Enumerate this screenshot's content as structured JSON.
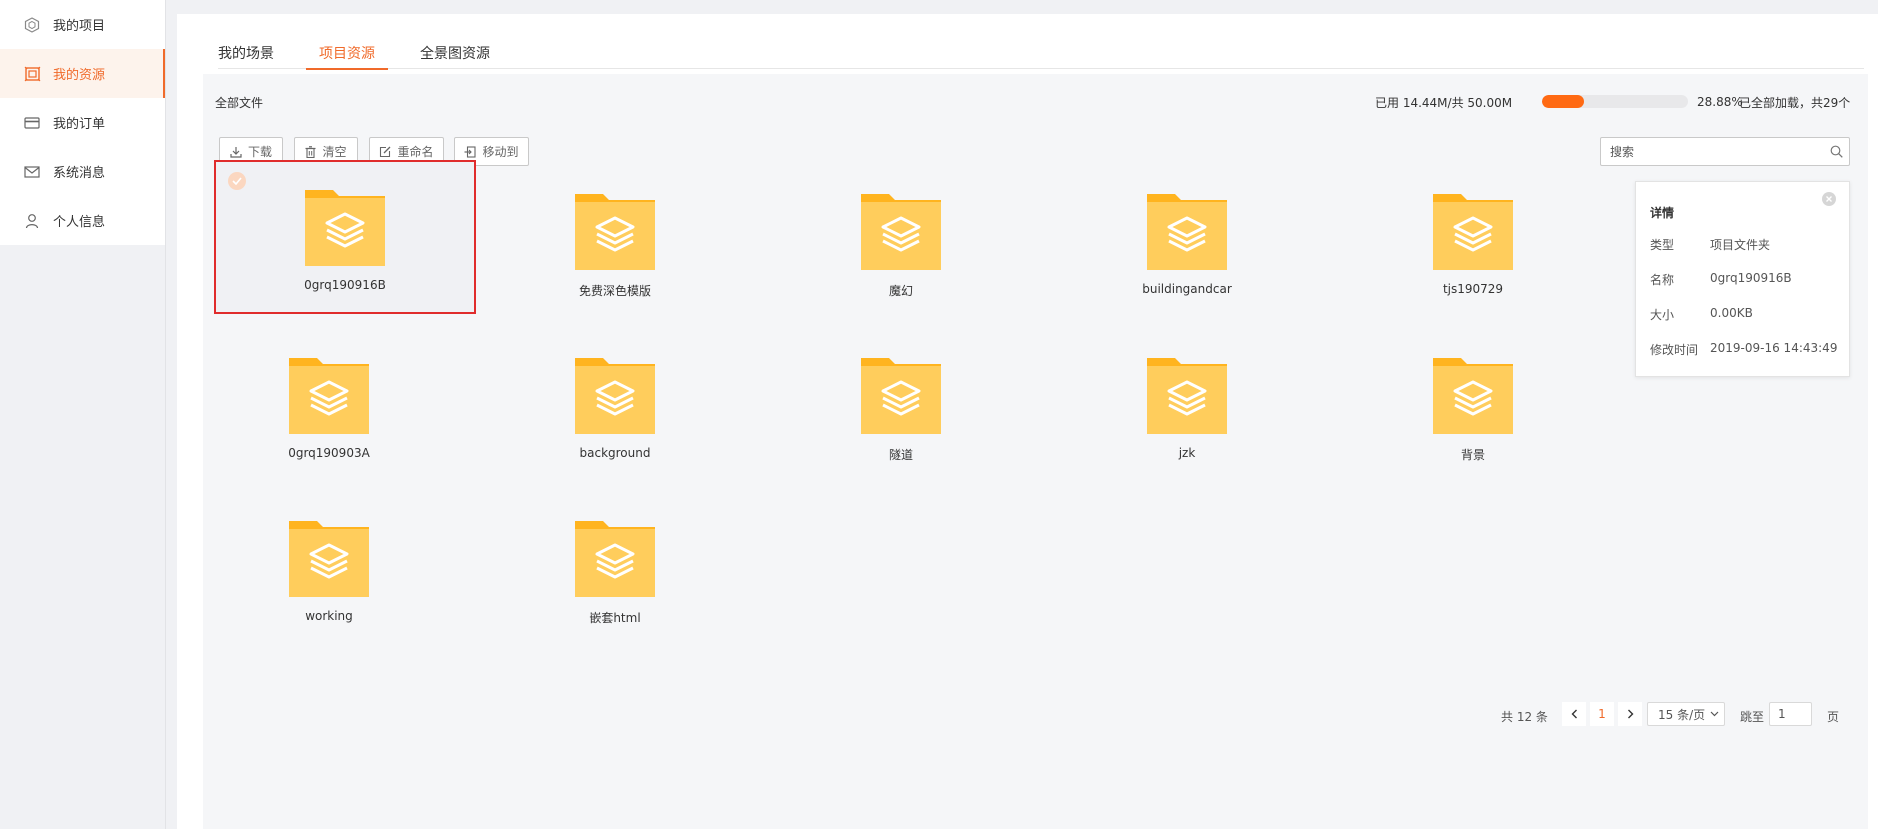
{
  "sidebar": {
    "items": [
      {
        "label": "我的项目",
        "icon": "hexagon-icon",
        "active": false
      },
      {
        "label": "我的资源",
        "icon": "resource-icon",
        "active": true
      },
      {
        "label": "我的订单",
        "icon": "card-icon",
        "active": false
      },
      {
        "label": "系统消息",
        "icon": "mail-icon",
        "active": false
      },
      {
        "label": "个人信息",
        "icon": "user-icon",
        "active": false
      }
    ]
  },
  "tabs": [
    {
      "label": "我的场景",
      "active": false
    },
    {
      "label": "项目资源",
      "active": true
    },
    {
      "label": "全景图资源",
      "active": false
    }
  ],
  "toolbar": {
    "all_files": "全部文件",
    "usage": "已用 14.44M/共 50.00M",
    "usage_fraction": 0.2888,
    "percent": "28.88%",
    "loaded": "已全部加载，共29个",
    "buttons": {
      "download": "下载",
      "clear": "清空",
      "rename": "重命名",
      "move": "移动到"
    },
    "search_placeholder": "搜索"
  },
  "folders": [
    {
      "name": "0grq190916B",
      "selected": true
    },
    {
      "name": "免费深色模版",
      "selected": false
    },
    {
      "name": "魔幻",
      "selected": false
    },
    {
      "name": "buildingandcar",
      "selected": false
    },
    {
      "name": "tjs190729",
      "selected": false
    },
    {
      "name": "0grq190903A",
      "selected": false
    },
    {
      "name": "background",
      "selected": false
    },
    {
      "name": "隧道",
      "selected": false
    },
    {
      "name": "jzk",
      "selected": false
    },
    {
      "name": "背景",
      "selected": false
    },
    {
      "name": "working",
      "selected": false
    },
    {
      "name": "嵌套html",
      "selected": false
    }
  ],
  "detail": {
    "title": "详情",
    "rows": [
      {
        "label": "类型",
        "value": "项目文件夹"
      },
      {
        "label": "名称",
        "value": "0grq190916B"
      },
      {
        "label": "大小",
        "value": "0.00KB"
      },
      {
        "label": "修改时间",
        "value": "2019-09-16 14:43:49"
      }
    ]
  },
  "pagination": {
    "total": "共 12 条",
    "current_page": "1",
    "page_size": "15 条/页",
    "jump_label": "跳至",
    "jump_value": "1",
    "page_suffix": "页"
  },
  "colors": {
    "accent": "#f06a2a",
    "progress": "#ff6a13",
    "folder": "#ffcd5c",
    "selection_border": "#e02c2c"
  }
}
